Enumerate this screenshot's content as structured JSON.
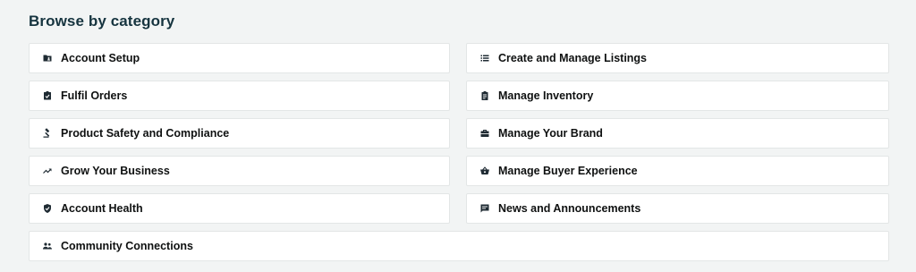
{
  "section": {
    "title": "Browse by category"
  },
  "categories": [
    {
      "label": "Account Setup",
      "icon": "folder-icon"
    },
    {
      "label": "Create and Manage Listings",
      "icon": "list-icon"
    },
    {
      "label": "Fulfil Orders",
      "icon": "checklist-icon"
    },
    {
      "label": "Manage Inventory",
      "icon": "clipboard-icon"
    },
    {
      "label": "Product Safety and Compliance",
      "icon": "gavel-icon"
    },
    {
      "label": "Manage Your Brand",
      "icon": "briefcase-icon"
    },
    {
      "label": "Grow Your Business",
      "icon": "trending-up-icon"
    },
    {
      "label": "Manage Buyer Experience",
      "icon": "basket-icon"
    },
    {
      "label": "Account Health",
      "icon": "shield-check-icon"
    },
    {
      "label": "News and Announcements",
      "icon": "chat-icon"
    },
    {
      "label": "Community Connections",
      "icon": "people-icon"
    }
  ],
  "colors": {
    "background": "#f2f4f4",
    "card_background": "#ffffff",
    "card_border": "#e3e6e6",
    "heading": "#16343f",
    "text": "#0f1111"
  }
}
